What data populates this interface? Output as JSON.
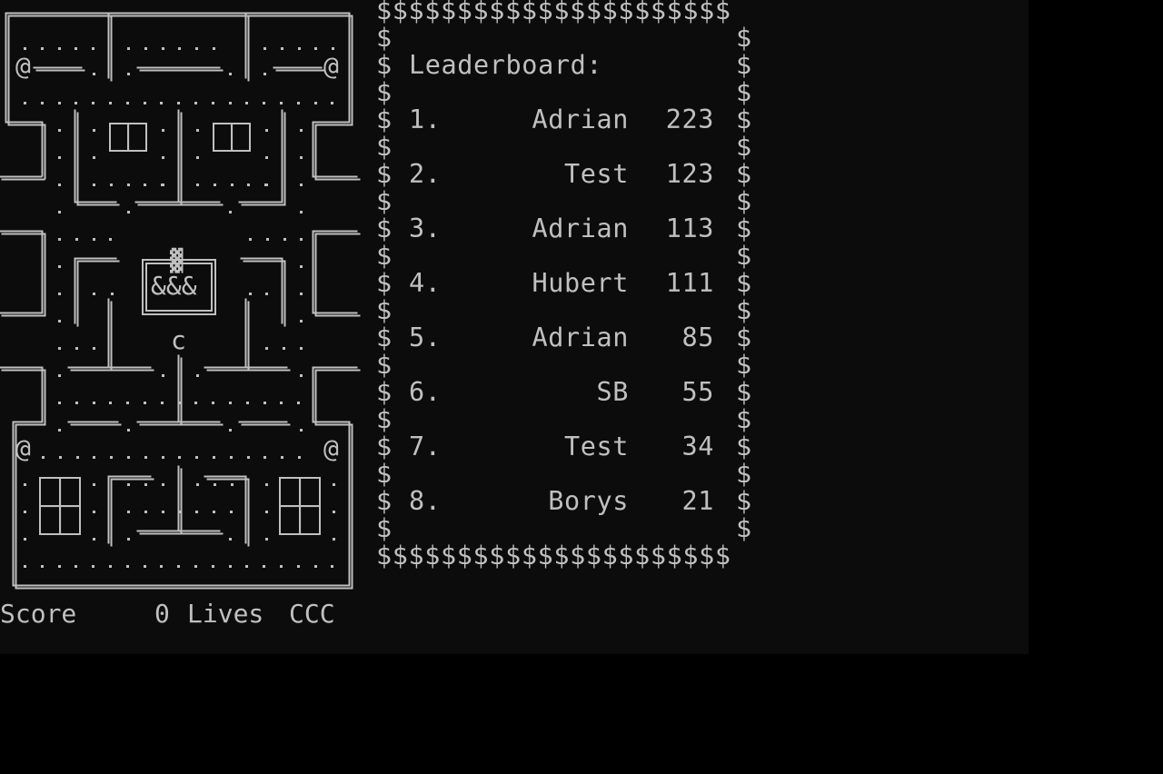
{
  "maze": {
    "power_pellet": "@",
    "ghost_house_ghosts": "&&&",
    "player_glyph": "c",
    "ghost_block_glyph": "▓"
  },
  "leaderboard": {
    "border_char": "$",
    "border_row": "$$$$$$$$$$$$$$$$$$$$$$",
    "title": "Leaderboard:",
    "entries": [
      {
        "rank": "1.",
        "name": "Adrian",
        "score": "223"
      },
      {
        "rank": "2.",
        "name": "Test",
        "score": "123"
      },
      {
        "rank": "3.",
        "name": "Adrian",
        "score": "113"
      },
      {
        "rank": "4.",
        "name": "Hubert",
        "score": "111"
      },
      {
        "rank": "5.",
        "name": "Adrian",
        "score": "85"
      },
      {
        "rank": "6.",
        "name": "SB",
        "score": "55"
      },
      {
        "rank": "7.",
        "name": "Test",
        "score": "34"
      },
      {
        "rank": "8.",
        "name": "Borys",
        "score": "21"
      }
    ]
  },
  "status": {
    "score_label": "Score",
    "score_value": "0",
    "lives_label": "Lives",
    "lives_value": "CCC"
  },
  "colors": {
    "text": "#c0c0c0",
    "console_bg": "#0c0c0c",
    "outer_bg": "#000000"
  }
}
